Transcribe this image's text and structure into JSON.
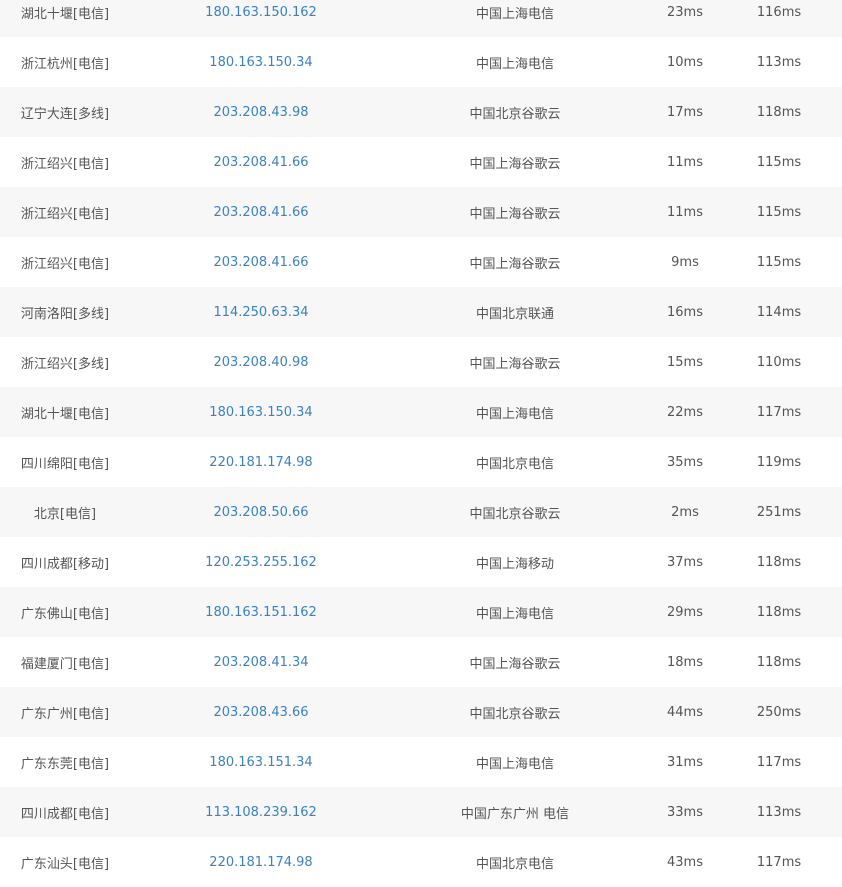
{
  "rows": [
    {
      "location": "湖北十堰[电信]",
      "ip": "180.163.150.162",
      "ip_location": "中国上海电信",
      "response": "23ms",
      "time": "116ms"
    },
    {
      "location": "浙江杭州[电信]",
      "ip": "180.163.150.34",
      "ip_location": "中国上海电信",
      "response": "10ms",
      "time": "113ms"
    },
    {
      "location": "辽宁大连[多线]",
      "ip": "203.208.43.98",
      "ip_location": "中国北京谷歌云",
      "response": "17ms",
      "time": "118ms"
    },
    {
      "location": "浙江绍兴[电信]",
      "ip": "203.208.41.66",
      "ip_location": "中国上海谷歌云",
      "response": "11ms",
      "time": "115ms"
    },
    {
      "location": "浙江绍兴[电信]",
      "ip": "203.208.41.66",
      "ip_location": "中国上海谷歌云",
      "response": "11ms",
      "time": "115ms"
    },
    {
      "location": "浙江绍兴[电信]",
      "ip": "203.208.41.66",
      "ip_location": "中国上海谷歌云",
      "response": "9ms",
      "time": "115ms"
    },
    {
      "location": "河南洛阳[多线]",
      "ip": "114.250.63.34",
      "ip_location": "中国北京联通",
      "response": "16ms",
      "time": "114ms"
    },
    {
      "location": "浙江绍兴[多线]",
      "ip": "203.208.40.98",
      "ip_location": "中国上海谷歌云",
      "response": "15ms",
      "time": "110ms"
    },
    {
      "location": "湖北十堰[电信]",
      "ip": "180.163.150.34",
      "ip_location": "中国上海电信",
      "response": "22ms",
      "time": "117ms"
    },
    {
      "location": "四川绵阳[电信]",
      "ip": "220.181.174.98",
      "ip_location": "中国北京电信",
      "response": "35ms",
      "time": "119ms"
    },
    {
      "location": "北京[电信]",
      "ip": "203.208.50.66",
      "ip_location": "中国北京谷歌云",
      "response": "2ms",
      "time": "251ms"
    },
    {
      "location": "四川成都[移动]",
      "ip": "120.253.255.162",
      "ip_location": "中国上海移动",
      "response": "37ms",
      "time": "118ms"
    },
    {
      "location": "广东佛山[电信]",
      "ip": "180.163.151.162",
      "ip_location": "中国上海电信",
      "response": "29ms",
      "time": "118ms"
    },
    {
      "location": "福建厦门[电信]",
      "ip": "203.208.41.34",
      "ip_location": "中国上海谷歌云",
      "response": "18ms",
      "time": "118ms"
    },
    {
      "location": "广东广州[电信]",
      "ip": "203.208.43.66",
      "ip_location": "中国北京谷歌云",
      "response": "44ms",
      "time": "250ms"
    },
    {
      "location": "广东东莞[电信]",
      "ip": "180.163.151.34",
      "ip_location": "中国上海电信",
      "response": "31ms",
      "time": "117ms"
    },
    {
      "location": "四川成都[电信]",
      "ip": "113.108.239.162",
      "ip_location": "中国广东广州 电信",
      "response": "33ms",
      "time": "113ms"
    },
    {
      "location": "广东汕头[电信]",
      "ip": "220.181.174.98",
      "ip_location": "中国北京电信",
      "response": "43ms",
      "time": "117ms"
    }
  ]
}
